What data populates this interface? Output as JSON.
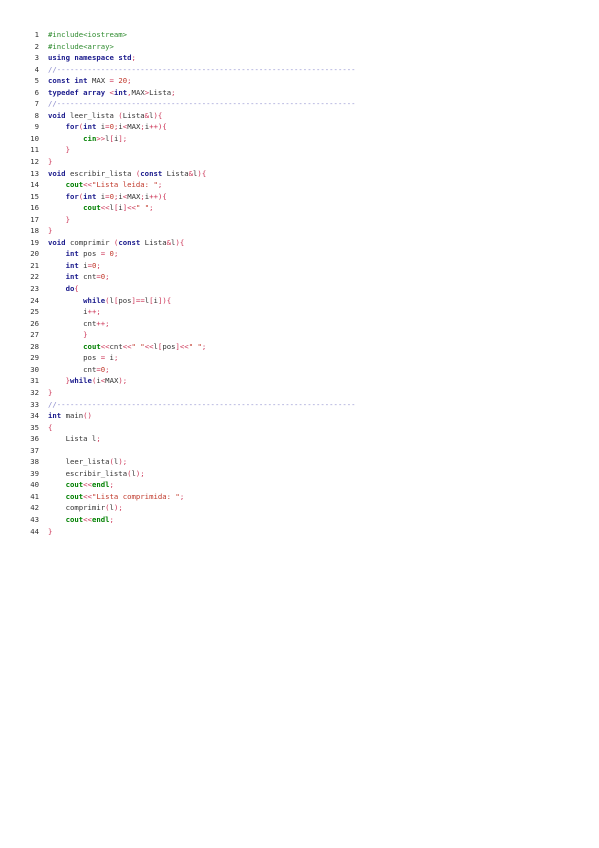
{
  "code": {
    "lines": [
      {
        "n": "1",
        "indent": 0,
        "tokens": [
          [
            "pp",
            "#include<iostream>"
          ]
        ]
      },
      {
        "n": "2",
        "indent": 0,
        "tokens": [
          [
            "pp",
            "#include<array>"
          ]
        ]
      },
      {
        "n": "3",
        "indent": 0,
        "tokens": [
          [
            "kw",
            "using"
          ],
          [
            "id",
            " "
          ],
          [
            "kw",
            "namespace"
          ],
          [
            "id",
            " "
          ],
          [
            "kw",
            "std"
          ],
          [
            "op",
            ";"
          ]
        ]
      },
      {
        "n": "4",
        "indent": 0,
        "tokens": [
          [
            "cm",
            "//--------------------------------------------------------------------"
          ]
        ]
      },
      {
        "n": "5",
        "indent": 0,
        "tokens": [
          [
            "kw",
            "const"
          ],
          [
            "id",
            " "
          ],
          [
            "ty",
            "int"
          ],
          [
            "id",
            " MAX "
          ],
          [
            "op",
            "="
          ],
          [
            "id",
            " "
          ],
          [
            "num",
            "20"
          ],
          [
            "op",
            ";"
          ]
        ]
      },
      {
        "n": "6",
        "indent": 0,
        "tokens": [
          [
            "kw",
            "typedef"
          ],
          [
            "id",
            " "
          ],
          [
            "kw",
            "array"
          ],
          [
            "id",
            " "
          ],
          [
            "op",
            "<"
          ],
          [
            "ty",
            "int"
          ],
          [
            "op",
            ","
          ],
          [
            "id",
            "MAX"
          ],
          [
            "op",
            ">"
          ],
          [
            "id",
            "Lista"
          ],
          [
            "op",
            ";"
          ]
        ]
      },
      {
        "n": "7",
        "indent": 0,
        "tokens": [
          [
            "cm",
            "//--------------------------------------------------------------------"
          ]
        ]
      },
      {
        "n": "8",
        "indent": 0,
        "tokens": [
          [
            "ty",
            "void"
          ],
          [
            "id",
            " leer_lista "
          ],
          [
            "op",
            "("
          ],
          [
            "id",
            "Lista"
          ],
          [
            "op",
            "&"
          ],
          [
            "id",
            "l"
          ],
          [
            "op",
            "){"
          ]
        ]
      },
      {
        "n": "9",
        "indent": 1,
        "tokens": [
          [
            "kw",
            "for"
          ],
          [
            "op",
            "("
          ],
          [
            "ty",
            "int"
          ],
          [
            "id",
            " i"
          ],
          [
            "op",
            "="
          ],
          [
            "num",
            "0"
          ],
          [
            "op",
            ";"
          ],
          [
            "id",
            "i"
          ],
          [
            "op",
            "<"
          ],
          [
            "id",
            "MAX"
          ],
          [
            "op",
            ";"
          ],
          [
            "id",
            "i"
          ],
          [
            "op",
            "++){"
          ]
        ]
      },
      {
        "n": "10",
        "indent": 2,
        "tokens": [
          [
            "io",
            "cin"
          ],
          [
            "op",
            ">>"
          ],
          [
            "id",
            "l"
          ],
          [
            "op",
            "["
          ],
          [
            "id",
            "i"
          ],
          [
            "op",
            "];"
          ]
        ]
      },
      {
        "n": "11",
        "indent": 1,
        "tokens": [
          [
            "op",
            "}"
          ]
        ]
      },
      {
        "n": "12",
        "indent": 0,
        "tokens": [
          [
            "op",
            "}"
          ]
        ]
      },
      {
        "n": "13",
        "indent": 0,
        "tokens": [
          [
            "ty",
            "void"
          ],
          [
            "id",
            " escribir_lista "
          ],
          [
            "op",
            "("
          ],
          [
            "kw",
            "const"
          ],
          [
            "id",
            " Lista"
          ],
          [
            "op",
            "&"
          ],
          [
            "id",
            "l"
          ],
          [
            "op",
            "){"
          ]
        ]
      },
      {
        "n": "14",
        "indent": 1,
        "tokens": [
          [
            "io",
            "cout"
          ],
          [
            "op",
            "<<"
          ],
          [
            "str",
            "\"Lista leida: \""
          ],
          [
            "op",
            ";"
          ]
        ]
      },
      {
        "n": "15",
        "indent": 1,
        "tokens": [
          [
            "kw",
            "for"
          ],
          [
            "op",
            "("
          ],
          [
            "ty",
            "int"
          ],
          [
            "id",
            " i"
          ],
          [
            "op",
            "="
          ],
          [
            "num",
            "0"
          ],
          [
            "op",
            ";"
          ],
          [
            "id",
            "i"
          ],
          [
            "op",
            "<"
          ],
          [
            "id",
            "MAX"
          ],
          [
            "op",
            ";"
          ],
          [
            "id",
            "i"
          ],
          [
            "op",
            "++){"
          ]
        ]
      },
      {
        "n": "16",
        "indent": 2,
        "tokens": [
          [
            "io",
            "cout"
          ],
          [
            "op",
            "<<"
          ],
          [
            "id",
            "l"
          ],
          [
            "op",
            "["
          ],
          [
            "id",
            "i"
          ],
          [
            "op",
            "]<<"
          ],
          [
            "str",
            "\" \""
          ],
          [
            "op",
            ";"
          ]
        ]
      },
      {
        "n": "17",
        "indent": 1,
        "tokens": [
          [
            "op",
            "}"
          ]
        ]
      },
      {
        "n": "18",
        "indent": 0,
        "tokens": [
          [
            "op",
            "}"
          ]
        ]
      },
      {
        "n": "19",
        "indent": 0,
        "tokens": [
          [
            "ty",
            "void"
          ],
          [
            "id",
            " comprimir "
          ],
          [
            "op",
            "("
          ],
          [
            "kw",
            "const"
          ],
          [
            "id",
            " Lista"
          ],
          [
            "op",
            "&"
          ],
          [
            "id",
            "l"
          ],
          [
            "op",
            "){"
          ]
        ]
      },
      {
        "n": "20",
        "indent": 1,
        "tokens": [
          [
            "ty",
            "int"
          ],
          [
            "id",
            " pos "
          ],
          [
            "op",
            "="
          ],
          [
            "id",
            " "
          ],
          [
            "num",
            "0"
          ],
          [
            "op",
            ";"
          ]
        ]
      },
      {
        "n": "21",
        "indent": 1,
        "tokens": [
          [
            "ty",
            "int"
          ],
          [
            "id",
            " i"
          ],
          [
            "op",
            "="
          ],
          [
            "num",
            "0"
          ],
          [
            "op",
            ";"
          ]
        ]
      },
      {
        "n": "22",
        "indent": 1,
        "tokens": [
          [
            "ty",
            "int"
          ],
          [
            "id",
            " cnt"
          ],
          [
            "op",
            "="
          ],
          [
            "num",
            "0"
          ],
          [
            "op",
            ";"
          ]
        ]
      },
      {
        "n": "23",
        "indent": 1,
        "tokens": [
          [
            "kw",
            "do"
          ],
          [
            "op",
            "{"
          ]
        ]
      },
      {
        "n": "24",
        "indent": 2,
        "tokens": [
          [
            "kw",
            "while"
          ],
          [
            "op",
            "("
          ],
          [
            "id",
            "l"
          ],
          [
            "op",
            "["
          ],
          [
            "id",
            "pos"
          ],
          [
            "op",
            "]=="
          ],
          [
            "id",
            "l"
          ],
          [
            "op",
            "["
          ],
          [
            "id",
            "i"
          ],
          [
            "op",
            "]){"
          ]
        ]
      },
      {
        "n": "25",
        "indent": 2,
        "tokens": [
          [
            "id",
            "i"
          ],
          [
            "op",
            "++;"
          ]
        ]
      },
      {
        "n": "26",
        "indent": 2,
        "tokens": [
          [
            "id",
            "cnt"
          ],
          [
            "op",
            "++;"
          ]
        ]
      },
      {
        "n": "27",
        "indent": 2,
        "tokens": [
          [
            "op",
            "}"
          ]
        ]
      },
      {
        "n": "28",
        "indent": 2,
        "tokens": [
          [
            "io",
            "cout"
          ],
          [
            "op",
            "<<"
          ],
          [
            "id",
            "cnt"
          ],
          [
            "op",
            "<<"
          ],
          [
            "str",
            "\" \""
          ],
          [
            "op",
            "<<"
          ],
          [
            "id",
            "l"
          ],
          [
            "op",
            "["
          ],
          [
            "id",
            "pos"
          ],
          [
            "op",
            "]<<"
          ],
          [
            "str",
            "\" \""
          ],
          [
            "op",
            ";"
          ]
        ]
      },
      {
        "n": "29",
        "indent": 2,
        "tokens": [
          [
            "id",
            "pos "
          ],
          [
            "op",
            "="
          ],
          [
            "id",
            " i"
          ],
          [
            "op",
            ";"
          ]
        ]
      },
      {
        "n": "30",
        "indent": 2,
        "tokens": [
          [
            "id",
            "cnt"
          ],
          [
            "op",
            "="
          ],
          [
            "num",
            "0"
          ],
          [
            "op",
            ";"
          ]
        ]
      },
      {
        "n": "31",
        "indent": 1,
        "tokens": [
          [
            "op",
            "}"
          ],
          [
            "kw",
            "while"
          ],
          [
            "op",
            "("
          ],
          [
            "id",
            "i"
          ],
          [
            "op",
            "<"
          ],
          [
            "id",
            "MAX"
          ],
          [
            "op",
            ");"
          ]
        ]
      },
      {
        "n": "32",
        "indent": 0,
        "tokens": [
          [
            "op",
            "}"
          ]
        ]
      },
      {
        "n": "33",
        "indent": 0,
        "tokens": [
          [
            "cm",
            "//--------------------------------------------------------------------"
          ]
        ]
      },
      {
        "n": "34",
        "indent": 0,
        "tokens": [
          [
            "ty",
            "int"
          ],
          [
            "id",
            " main"
          ],
          [
            "op",
            "()"
          ]
        ]
      },
      {
        "n": "35",
        "indent": 0,
        "tokens": [
          [
            "op",
            "{"
          ]
        ]
      },
      {
        "n": "36",
        "indent": 1,
        "tokens": [
          [
            "id",
            "Lista l"
          ],
          [
            "op",
            ";"
          ]
        ]
      },
      {
        "n": "37",
        "indent": 0,
        "tokens": []
      },
      {
        "n": "38",
        "indent": 1,
        "tokens": [
          [
            "id",
            "leer_lista"
          ],
          [
            "op",
            "("
          ],
          [
            "id",
            "l"
          ],
          [
            "op",
            ");"
          ]
        ]
      },
      {
        "n": "39",
        "indent": 1,
        "tokens": [
          [
            "id",
            "escribir_lista"
          ],
          [
            "op",
            "("
          ],
          [
            "id",
            "l"
          ],
          [
            "op",
            ");"
          ]
        ]
      },
      {
        "n": "40",
        "indent": 1,
        "tokens": [
          [
            "io",
            "cout"
          ],
          [
            "op",
            "<<"
          ],
          [
            "io",
            "endl"
          ],
          [
            "op",
            ";"
          ]
        ]
      },
      {
        "n": "41",
        "indent": 1,
        "tokens": [
          [
            "io",
            "cout"
          ],
          [
            "op",
            "<<"
          ],
          [
            "str",
            "\"Lista comprimida: \""
          ],
          [
            "op",
            ";"
          ]
        ]
      },
      {
        "n": "42",
        "indent": 1,
        "tokens": [
          [
            "id",
            "comprimir"
          ],
          [
            "op",
            "("
          ],
          [
            "id",
            "l"
          ],
          [
            "op",
            ");"
          ]
        ]
      },
      {
        "n": "43",
        "indent": 1,
        "tokens": [
          [
            "io",
            "cout"
          ],
          [
            "op",
            "<<"
          ],
          [
            "io",
            "endl"
          ],
          [
            "op",
            ";"
          ]
        ]
      },
      {
        "n": "44",
        "indent": 0,
        "tokens": [
          [
            "op",
            "}"
          ]
        ]
      }
    ]
  }
}
